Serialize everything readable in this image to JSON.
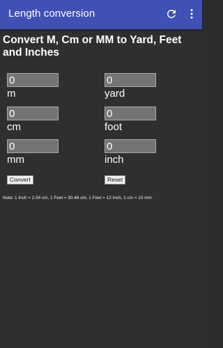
{
  "appbar": {
    "title": "Length conversion",
    "icons": [
      "refresh-icon",
      "more-vert-icon"
    ]
  },
  "heading": "Convert M, Cm or MM to Yard, Feet and Inches",
  "fields": {
    "m": {
      "value": "0",
      "unit": "m"
    },
    "cm": {
      "value": "0",
      "unit": "cm"
    },
    "mm": {
      "value": "0",
      "unit": "mm"
    },
    "yard": {
      "value": "0",
      "unit": "yard"
    },
    "foot": {
      "value": "0",
      "unit": "foot"
    },
    "inch": {
      "value": "0",
      "unit": "inch"
    }
  },
  "buttons": {
    "convert": "Convert",
    "reset": "Reset"
  },
  "note": "Note: 1 Inch = 2.54 cm, 1 Feet = 30.48 cm, 1 Feet = 12 Inch, 1 cm = 10 mm",
  "colors": {
    "appbar": "#3f51b5",
    "background": "#2f2f2f",
    "input_background": "#747474"
  }
}
